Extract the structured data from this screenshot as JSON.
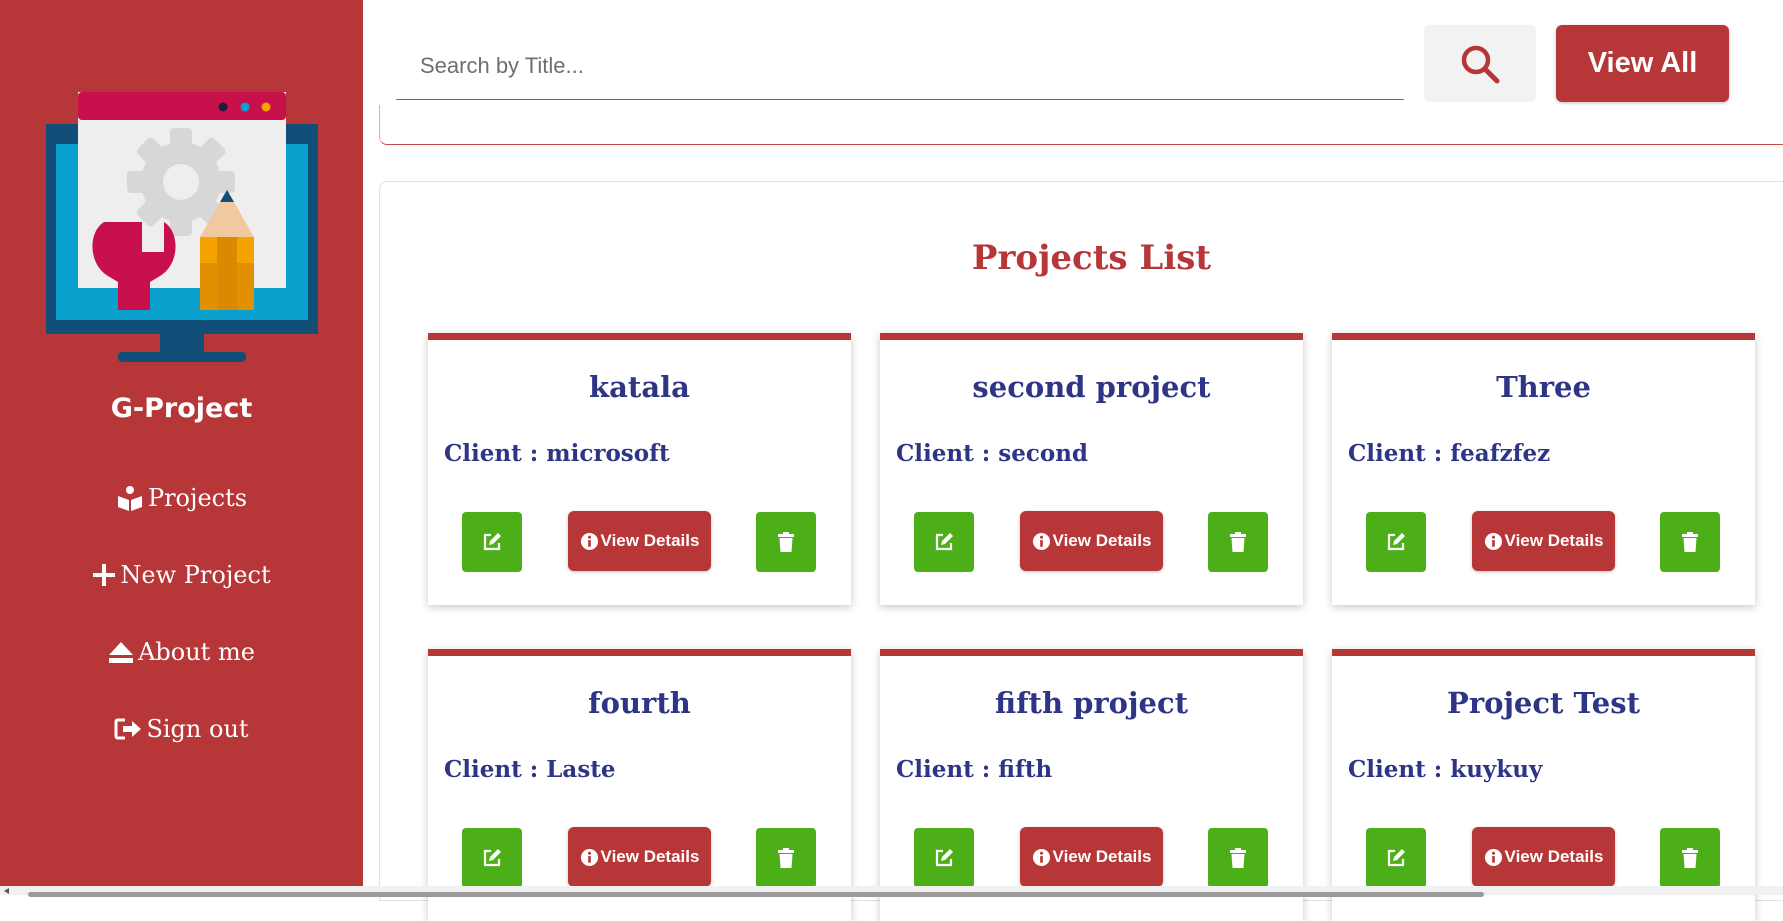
{
  "sidebar": {
    "brand": "G-Project",
    "items": [
      {
        "label": "Projects",
        "icon": "box-open-icon"
      },
      {
        "label": "New Project",
        "icon": "plus-icon"
      },
      {
        "label": "About me",
        "icon": "eject-icon"
      },
      {
        "label": "Sign out",
        "icon": "sign-out-icon"
      }
    ]
  },
  "search": {
    "placeholder": "Search by Title...",
    "view_all_label": "View All"
  },
  "main": {
    "title": "Projects List",
    "client_prefix": "Client : ",
    "details_label": "View Details",
    "projects": [
      {
        "title": "katala",
        "client": "Client : microsoft"
      },
      {
        "title": "second project",
        "client": "Client : second"
      },
      {
        "title": "Three",
        "client": "Client : feafzfez"
      },
      {
        "title": "fourth",
        "client": "Client : Laste"
      },
      {
        "title": "fifth project",
        "client": "Client : fifth"
      },
      {
        "title": "Project Test",
        "client": "Client : kuykuy"
      }
    ]
  },
  "colors": {
    "brand_red": "#b73637",
    "action_green": "#4caf17",
    "card_text_navy": "#2e3586"
  }
}
